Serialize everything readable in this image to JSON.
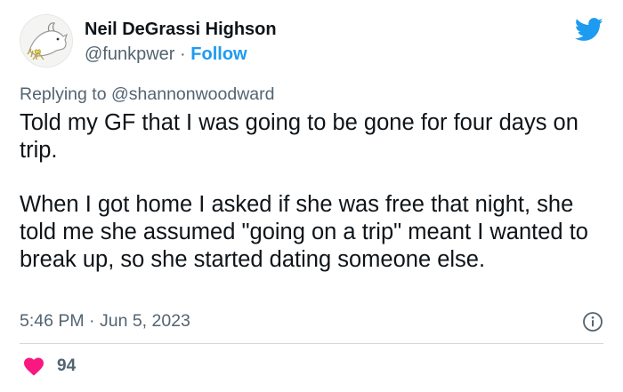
{
  "tweet": {
    "display_name": "Neil DeGrassi Highson",
    "handle": "@funkpwer",
    "separator": "·",
    "follow_label": "Follow",
    "replying_prefix": "Replying to",
    "replying_to": "@shannonwoodward",
    "paragraphs": [
      "Told my GF that I was going to be gone for four days on trip.",
      "When I got home I asked if she was free that night, she told me she assumed \"going on a trip\" meant I wanted to break up, so she started dating someone else."
    ],
    "time": "5:46 PM",
    "date": "Jun 5, 2023",
    "like_count": "94"
  },
  "icons": {
    "brand": "twitter-bird-icon",
    "info": "info-icon",
    "like": "heart-icon"
  },
  "colors": {
    "accent": "#1d9bf0",
    "heart": "#f91880",
    "muted_text": "#536471",
    "main_text": "#0f1419"
  }
}
